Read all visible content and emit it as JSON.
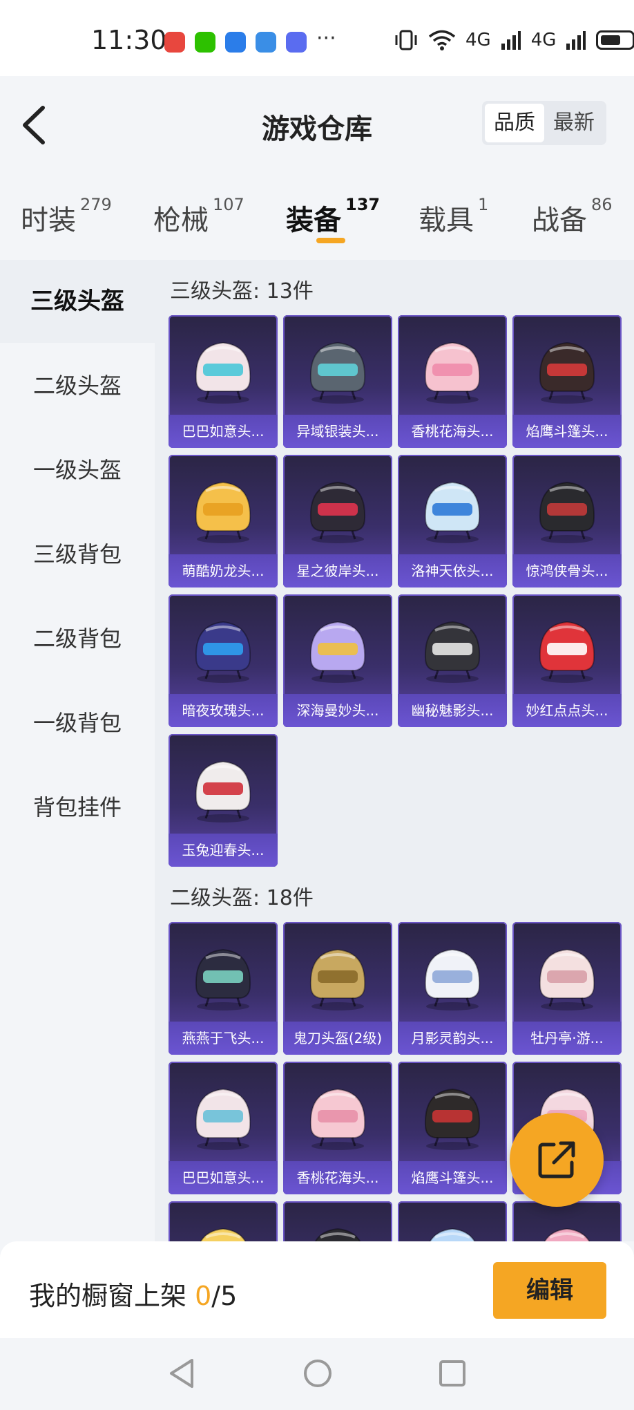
{
  "status_bar": {
    "time": "11:30",
    "more": "···",
    "signal1": "4G",
    "signal2": "4G",
    "app_colors": [
      "#e8473e",
      "#2dc100",
      "#2b7de9",
      "#3a8ee6",
      "#5a6cf0"
    ]
  },
  "header": {
    "title": "游戏仓库",
    "sort_options": [
      "品质",
      "最新"
    ],
    "sort_selected": "品质"
  },
  "categories": [
    {
      "label": "时装",
      "count": "279",
      "active": false
    },
    {
      "label": "枪械",
      "count": "107",
      "active": false
    },
    {
      "label": "装备",
      "count": "137",
      "active": true
    },
    {
      "label": "载具",
      "count": "1",
      "active": false
    },
    {
      "label": "战备",
      "count": "86",
      "active": false
    }
  ],
  "sidebar": {
    "items": [
      "三级头盔",
      "二级头盔",
      "一级头盔",
      "三级背包",
      "二级背包",
      "一级背包",
      "背包挂件"
    ],
    "active_index": 0
  },
  "sections": [
    {
      "title": "三级头盔: 13件",
      "items": [
        {
          "name": "巴巴如意头...",
          "color": "#f2e4e8",
          "accent": "#4ac6d8"
        },
        {
          "name": "异域银装头...",
          "color": "#5a6570",
          "accent": "#5fd0d8"
        },
        {
          "name": "香桃花海头...",
          "color": "#f6c2cf",
          "accent": "#f08cab"
        },
        {
          "name": "焰鹰斗篷头...",
          "color": "#3a2a2a",
          "accent": "#d63a3a"
        },
        {
          "name": "萌酷奶龙头...",
          "color": "#f5c04a",
          "accent": "#e8a020"
        },
        {
          "name": "星之彼岸头...",
          "color": "#2e2a36",
          "accent": "#e0334e"
        },
        {
          "name": "洛神天依头...",
          "color": "#cfe6f6",
          "accent": "#2e7ad8"
        },
        {
          "name": "惊鸿侠骨头...",
          "color": "#2a2a2e",
          "accent": "#c23a3a"
        },
        {
          "name": "暗夜玫瑰头...",
          "color": "#3a3a8a",
          "accent": "#2fa0f0"
        },
        {
          "name": "深海曼妙头...",
          "color": "#b8a8f0",
          "accent": "#f0c040"
        },
        {
          "name": "幽秘魅影头...",
          "color": "#34343a",
          "accent": "#e6e6e6"
        },
        {
          "name": "妙红点点头...",
          "color": "#e0343a",
          "accent": "#ffffff"
        },
        {
          "name": "玉兔迎春头...",
          "color": "#f0ecec",
          "accent": "#d0303a"
        }
      ]
    },
    {
      "title": "二级头盔: 18件",
      "items": [
        {
          "name": "燕燕于飞头...",
          "color": "#2c2c40",
          "accent": "#7ad0c0"
        },
        {
          "name": "鬼刀头盔(2级)",
          "color": "#c8a860",
          "accent": "#8a6a2a"
        },
        {
          "name": "月影灵韵头...",
          "color": "#f0f2f8",
          "accent": "#8fa8d8"
        },
        {
          "name": "牡丹亭·游...",
          "color": "#f4e0e0",
          "accent": "#d8a0a8"
        },
        {
          "name": "巴巴如意头...",
          "color": "#f2e4e8",
          "accent": "#6ac0d8"
        },
        {
          "name": "香桃花海头...",
          "color": "#f6c8d2",
          "accent": "#e890a8"
        },
        {
          "name": "焰鹰斗篷头...",
          "color": "#2e2a2a",
          "accent": "#c83434"
        },
        {
          "name": "",
          "color": "#f4d8e0",
          "accent": "#f0a8c0"
        },
        {
          "name": "",
          "color": "#f5d060",
          "accent": "#e0a030"
        },
        {
          "name": "",
          "color": "#2a2a30",
          "accent": "#c03030"
        },
        {
          "name": "",
          "color": "#b8d8f8",
          "accent": "#f0a8c8"
        },
        {
          "name": "",
          "color": "#f0a8c0",
          "accent": "#e87098"
        }
      ]
    }
  ],
  "bottom_bar": {
    "label": "我的橱窗上架 ",
    "current": "0",
    "sep_total": "/5",
    "edit_label": "编辑"
  }
}
